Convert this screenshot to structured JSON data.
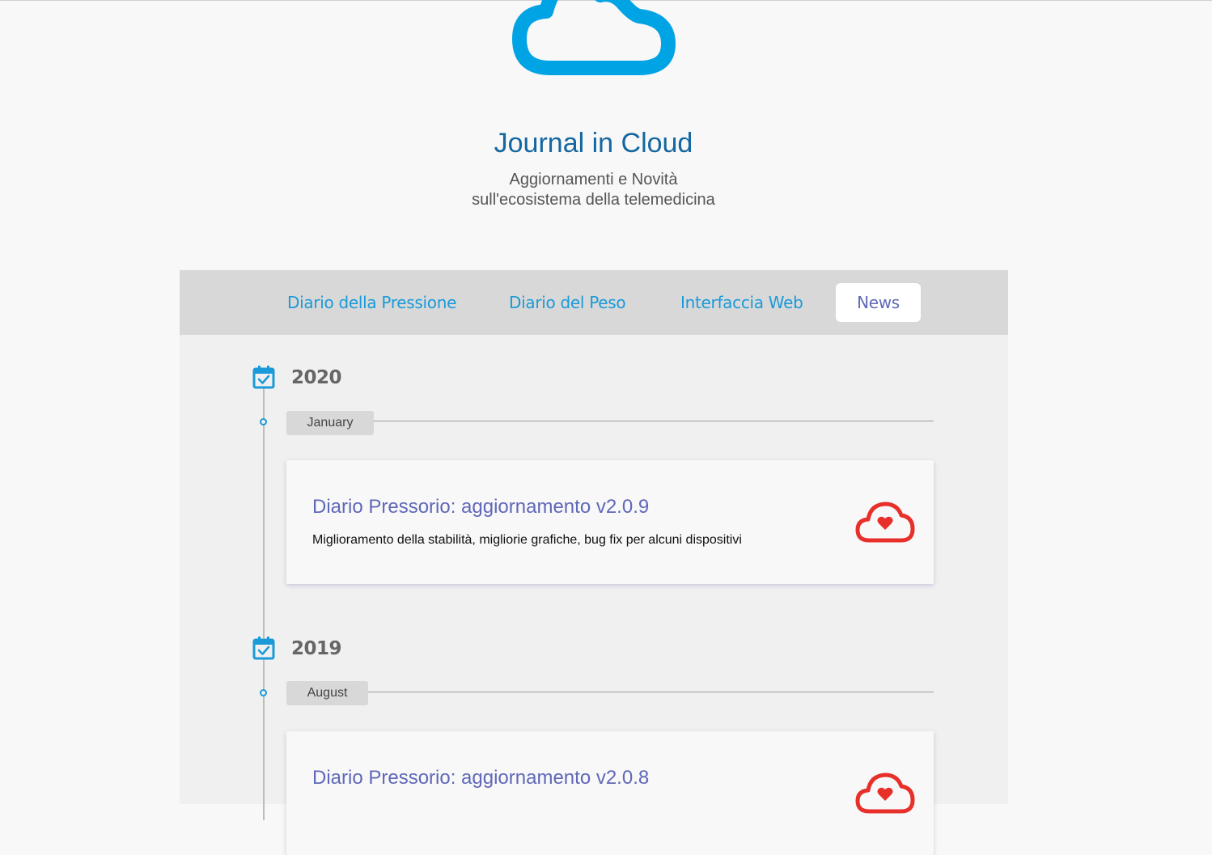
{
  "header": {
    "title": "Journal in Cloud",
    "subtitle_line1": "Aggiornamenti e Novità",
    "subtitle_line2": "sull'ecosistema della telemedicina",
    "logo_icon": "cloud-logo-icon"
  },
  "nav": {
    "tabs": [
      {
        "label": "Diario della Pressione"
      },
      {
        "label": "Diario del Peso"
      },
      {
        "label": "Interfaccia Web"
      },
      {
        "label": "News"
      }
    ],
    "active": "News"
  },
  "timeline": [
    {
      "year": "2020",
      "month": "January",
      "entry": {
        "title": "Diario Pressorio: aggiornamento v2.0.9",
        "text": "Miglioramento della stabilità, migliorie grafiche, bug fix per alcuni dispositivi",
        "icon": "cloud-heart-icon"
      }
    },
    {
      "year": "2019",
      "month": "August",
      "entry": {
        "title": "Diario Pressorio: aggiornamento v2.0.8",
        "icon": "cloud-heart-icon"
      }
    }
  ],
  "colors": {
    "accent": "#1a9ad8",
    "title": "#1467a0",
    "entry_title": "#6068b8",
    "heart_icon": "#e8302a",
    "nav_bg": "#d8d8d8",
    "panel_bg": "#f0f0f0"
  }
}
